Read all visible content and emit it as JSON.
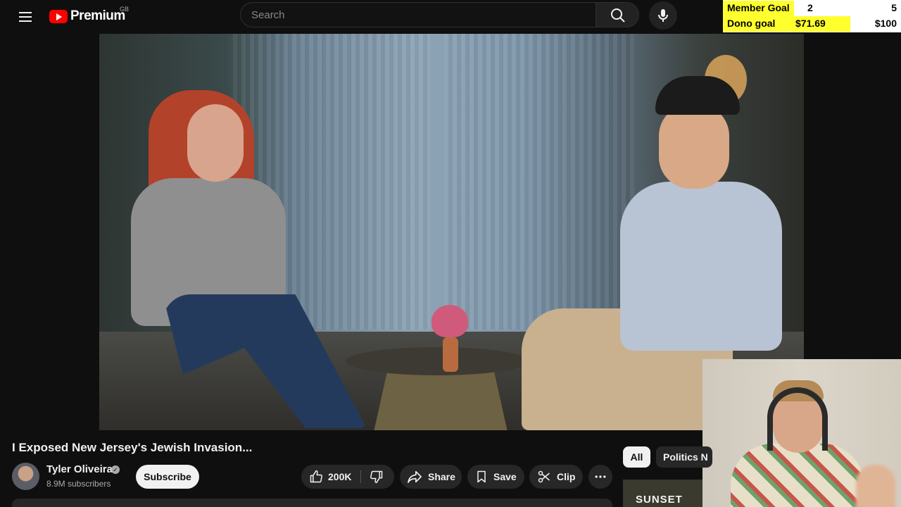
{
  "header": {
    "logo_text": "Premium",
    "region": "GB",
    "search": {
      "placeholder": "Search",
      "value": ""
    },
    "icons": [
      "menu-icon",
      "search-icon",
      "mic-icon"
    ]
  },
  "overlay": {
    "member_goal": {
      "label": "Member Goal",
      "current": "2",
      "target": "5"
    },
    "dono_goal": {
      "label": "Dono goal",
      "current": "$71.69",
      "target": "$100"
    },
    "accent_color": "#ffff2e"
  },
  "video": {
    "title": "I Exposed New Jersey's Jewish Invasion...",
    "channel": {
      "name": "Tyler Oliveira",
      "subscribers": "8.9M subscribers",
      "verified": true
    },
    "subscribe_label": "Subscribe",
    "actions": {
      "like_count": "200K",
      "share_label": "Share",
      "save_label": "Save",
      "clip_label": "Clip"
    }
  },
  "sidebar": {
    "chips": [
      {
        "label": "All",
        "selected": true
      },
      {
        "label": "Politics N",
        "selected": false
      }
    ],
    "recommendation_thumb_text": "SUNSET"
  },
  "colors": {
    "background": "#0f0f0f",
    "brand_red": "#ff0000",
    "pill_bg": "#272727"
  }
}
